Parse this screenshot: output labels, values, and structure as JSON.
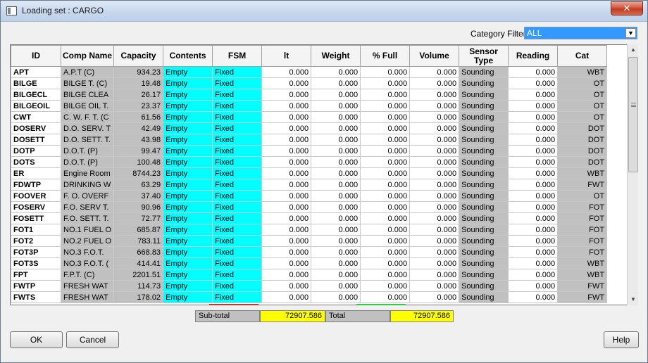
{
  "window": {
    "title": "Loading set : CARGO",
    "close_label": "✕"
  },
  "filter": {
    "label": "Category Filter",
    "value": "ALL"
  },
  "columns": [
    "ID",
    "Comp Name",
    "Capacity",
    "Contents",
    "FSM",
    "lt",
    "Weight",
    "% Full",
    "Volume",
    "Sensor Type",
    "Reading",
    "Cat"
  ],
  "rows": [
    {
      "id": "APT",
      "name": "A.P.T (C)",
      "capacity": "934.23",
      "contents": "Empty",
      "fsm": "Fixed",
      "lt": "0.000",
      "weight": "0.000",
      "full": "0.000",
      "volume": "0.000",
      "sensor": "Sounding",
      "reading": "0.000",
      "cat": "WBT"
    },
    {
      "id": "BILGE",
      "name": "BILGE T. (C)",
      "capacity": "19.48",
      "contents": "Empty",
      "fsm": "Fixed",
      "lt": "0.000",
      "weight": "0.000",
      "full": "0.000",
      "volume": "0.000",
      "sensor": "Sounding",
      "reading": "0.000",
      "cat": "OT"
    },
    {
      "id": "BILGECL",
      "name": "BILGE CLEA",
      "capacity": "26.17",
      "contents": "Empty",
      "fsm": "Fixed",
      "lt": "0.000",
      "weight": "0.000",
      "full": "0.000",
      "volume": "0.000",
      "sensor": "Sounding",
      "reading": "0.000",
      "cat": "OT"
    },
    {
      "id": "BILGEOIL",
      "name": "BILGE OIL T.",
      "capacity": "23.37",
      "contents": "Empty",
      "fsm": "Fixed",
      "lt": "0.000",
      "weight": "0.000",
      "full": "0.000",
      "volume": "0.000",
      "sensor": "Sounding",
      "reading": "0.000",
      "cat": "OT"
    },
    {
      "id": "CWT",
      "name": "C. W. F. T. (C",
      "capacity": "61.56",
      "contents": "Empty",
      "fsm": "Fixed",
      "lt": "0.000",
      "weight": "0.000",
      "full": "0.000",
      "volume": "0.000",
      "sensor": "Sounding",
      "reading": "0.000",
      "cat": "OT"
    },
    {
      "id": "DOSERV",
      "name": "D.O. SERV. T",
      "capacity": "42.49",
      "contents": "Empty",
      "fsm": "Fixed",
      "lt": "0.000",
      "weight": "0.000",
      "full": "0.000",
      "volume": "0.000",
      "sensor": "Sounding",
      "reading": "0.000",
      "cat": "DOT"
    },
    {
      "id": "DOSETT",
      "name": "D.O. SETT. T.",
      "capacity": "43.98",
      "contents": "Empty",
      "fsm": "Fixed",
      "lt": "0.000",
      "weight": "0.000",
      "full": "0.000",
      "volume": "0.000",
      "sensor": "Sounding",
      "reading": "0.000",
      "cat": "DOT"
    },
    {
      "id": "DOTP",
      "name": "D.O.T. (P)",
      "capacity": "99.47",
      "contents": "Empty",
      "fsm": "Fixed",
      "lt": "0.000",
      "weight": "0.000",
      "full": "0.000",
      "volume": "0.000",
      "sensor": "Sounding",
      "reading": "0.000",
      "cat": "DOT"
    },
    {
      "id": "DOTS",
      "name": "D.O.T. (P)",
      "capacity": "100.48",
      "contents": "Empty",
      "fsm": "Fixed",
      "lt": "0.000",
      "weight": "0.000",
      "full": "0.000",
      "volume": "0.000",
      "sensor": "Sounding",
      "reading": "0.000",
      "cat": "DOT"
    },
    {
      "id": "ER",
      "name": "Engine Room",
      "capacity": "8744.23",
      "contents": "Empty",
      "fsm": "Fixed",
      "lt": "0.000",
      "weight": "0.000",
      "full": "0.000",
      "volume": "0.000",
      "sensor": "Sounding",
      "reading": "0.000",
      "cat": "WBT"
    },
    {
      "id": "FDWTP",
      "name": "DRINKING W",
      "capacity": "63.29",
      "contents": "Empty",
      "fsm": "Fixed",
      "lt": "0.000",
      "weight": "0.000",
      "full": "0.000",
      "volume": "0.000",
      "sensor": "Sounding",
      "reading": "0.000",
      "cat": "FWT"
    },
    {
      "id": "FOOVER",
      "name": "F. O. OVERF",
      "capacity": "37.40",
      "contents": "Empty",
      "fsm": "Fixed",
      "lt": "0.000",
      "weight": "0.000",
      "full": "0.000",
      "volume": "0.000",
      "sensor": "Sounding",
      "reading": "0.000",
      "cat": "OT"
    },
    {
      "id": "FOSERV",
      "name": "F.O. SERV T.",
      "capacity": "90.96",
      "contents": "Empty",
      "fsm": "Fixed",
      "lt": "0.000",
      "weight": "0.000",
      "full": "0.000",
      "volume": "0.000",
      "sensor": "Sounding",
      "reading": "0.000",
      "cat": "FOT"
    },
    {
      "id": "FOSETT",
      "name": "F.O. SETT. T.",
      "capacity": "72.77",
      "contents": "Empty",
      "fsm": "Fixed",
      "lt": "0.000",
      "weight": "0.000",
      "full": "0.000",
      "volume": "0.000",
      "sensor": "Sounding",
      "reading": "0.000",
      "cat": "FOT"
    },
    {
      "id": "FOT1",
      "name": "NO.1 FUEL O",
      "capacity": "685.87",
      "contents": "Empty",
      "fsm": "Fixed",
      "lt": "0.000",
      "weight": "0.000",
      "full": "0.000",
      "volume": "0.000",
      "sensor": "Sounding",
      "reading": "0.000",
      "cat": "FOT"
    },
    {
      "id": "FOT2",
      "name": "NO.2 FUEL O",
      "capacity": "783.11",
      "contents": "Empty",
      "fsm": "Fixed",
      "lt": "0.000",
      "weight": "0.000",
      "full": "0.000",
      "volume": "0.000",
      "sensor": "Sounding",
      "reading": "0.000",
      "cat": "FOT"
    },
    {
      "id": "FOT3P",
      "name": "NO.3 F.O.T.",
      "capacity": "668.83",
      "contents": "Empty",
      "fsm": "Fixed",
      "lt": "0.000",
      "weight": "0.000",
      "full": "0.000",
      "volume": "0.000",
      "sensor": "Sounding",
      "reading": "0.000",
      "cat": "FOT"
    },
    {
      "id": "FOT3S",
      "name": "NO.3 F.O.T. (",
      "capacity": "414.41",
      "contents": "Empty",
      "fsm": "Fixed",
      "lt": "0.000",
      "weight": "0.000",
      "full": "0.000",
      "volume": "0.000",
      "sensor": "Sounding",
      "reading": "0.000",
      "cat": "WBT"
    },
    {
      "id": "FPT",
      "name": "F.P.T. (C)",
      "capacity": "2201.51",
      "contents": "Empty",
      "fsm": "Fixed",
      "lt": "0.000",
      "weight": "0.000",
      "full": "0.000",
      "volume": "0.000",
      "sensor": "Sounding",
      "reading": "0.000",
      "cat": "WBT"
    },
    {
      "id": "FWTP",
      "name": "FRESH WAT",
      "capacity": "114.73",
      "contents": "Empty",
      "fsm": "Fixed",
      "lt": "0.000",
      "weight": "0.000",
      "full": "0.000",
      "volume": "0.000",
      "sensor": "Sounding",
      "reading": "0.000",
      "cat": "FWT"
    },
    {
      "id": "FWTS",
      "name": "FRESH WAT",
      "capacity": "178.02",
      "contents": "Empty",
      "fsm": "Fixed",
      "lt": "0.000",
      "weight": "0.000",
      "full": "0.000",
      "volume": "0.000",
      "sensor": "Sounding",
      "reading": "0.000",
      "cat": "FWT"
    }
  ],
  "totals": {
    "subtotal_label": "Sub-total",
    "subtotal_value": "72907.586",
    "total_label": "Total",
    "total_value": "72907.586"
  },
  "buttons": {
    "ok": "OK",
    "cancel": "Cancel",
    "help": "Help"
  },
  "colors": {
    "contents_bg": "#00ffff",
    "readonly_bg": "#c0c0c0",
    "total_bg": "#ffff00",
    "selection": "#3399ff"
  }
}
